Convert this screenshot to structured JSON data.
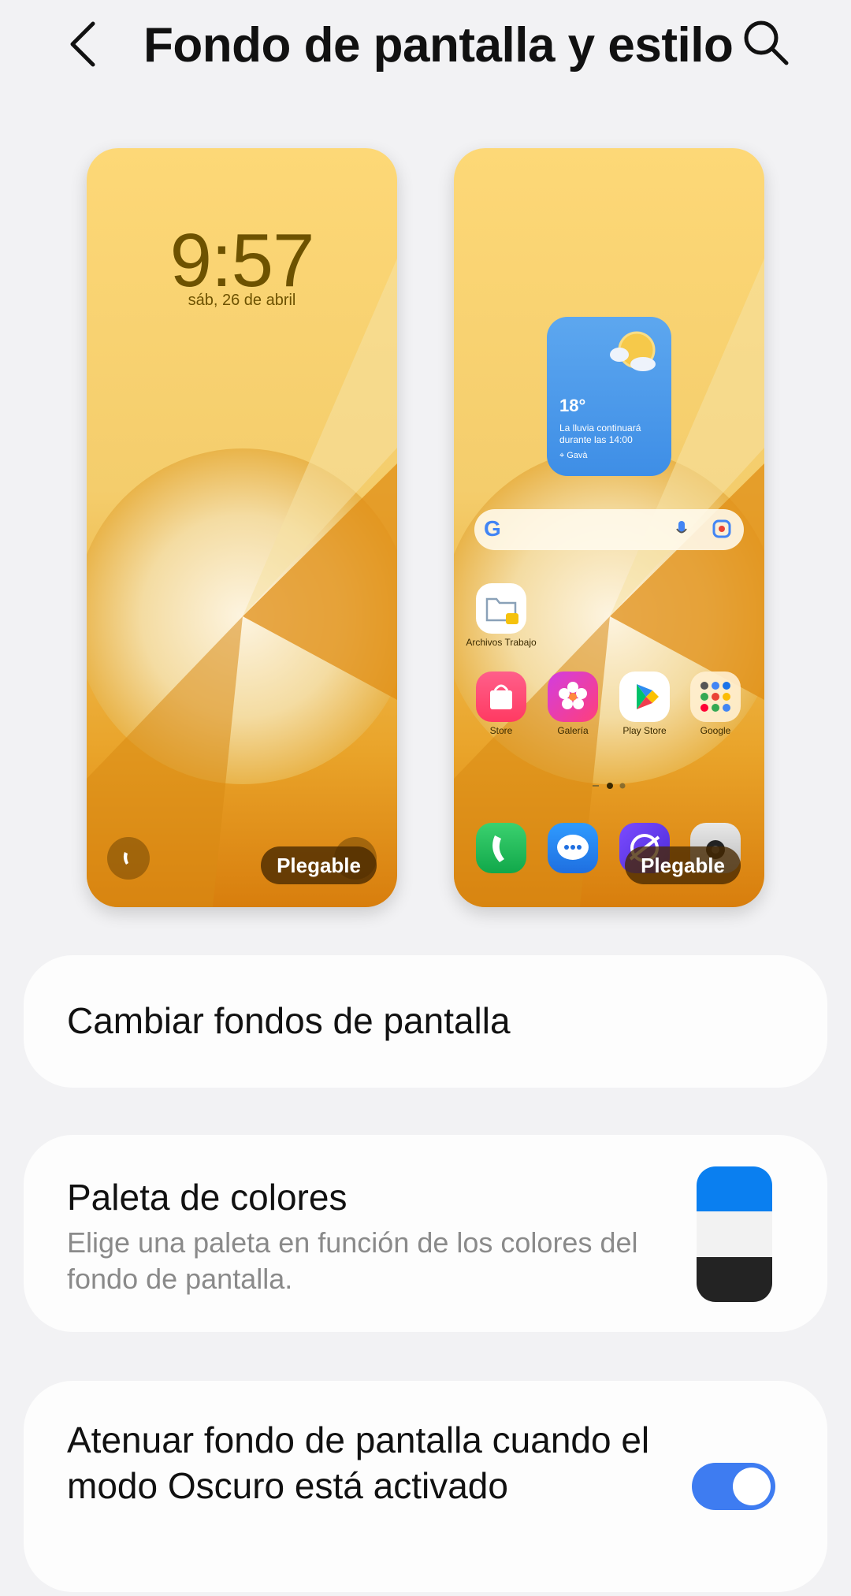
{
  "header": {
    "title": "Fondo de pantalla y estilo",
    "back_icon": "chevron-left-icon",
    "search_icon": "search-icon"
  },
  "lock_preview": {
    "time": "9:57",
    "date": "sáb, 26 de abril",
    "badge": "Plegable",
    "left_shortcut_icon": "phone-icon",
    "right_shortcut_icon": "camera-icon"
  },
  "home_preview": {
    "badge": "Plegable",
    "weather": {
      "temp": "18°",
      "desc": "La lluvia continuará durante las 14:00",
      "location": "Gavà",
      "icon": "partly-cloudy-icon"
    },
    "search_bar_icons": [
      "google-icon",
      "microphone-icon",
      "lens-icon"
    ],
    "folder": {
      "label": "Archivos Trabajo",
      "icon": "folder-icon"
    },
    "apps": [
      {
        "label": "Store",
        "icon": "store-bag-icon"
      },
      {
        "label": "Galería",
        "icon": "gallery-flower-icon"
      },
      {
        "label": "Play Store",
        "icon": "play-store-icon"
      },
      {
        "label": "Google",
        "icon": "google-folder-icon"
      }
    ],
    "dock": [
      {
        "icon": "phone-icon"
      },
      {
        "icon": "messages-icon"
      },
      {
        "icon": "internet-icon"
      },
      {
        "icon": "camera-icon"
      }
    ]
  },
  "settings": {
    "change_wallpaper": "Cambiar fondos de pantalla",
    "palette_title": "Paleta de colores",
    "palette_sub": "Elige una paleta en función de los colores del fondo de pantalla.",
    "palette_colors": [
      "#0a7ff0",
      "#f2f2f2",
      "#232323"
    ],
    "dim_title": "Atenuar fondo de pantalla cuando el modo Oscuro está activado",
    "dim_toggle_on": true
  },
  "colors": {
    "accent": "#3e7cf1",
    "background": "#f2f2f4",
    "card": "#fdfdfd"
  }
}
